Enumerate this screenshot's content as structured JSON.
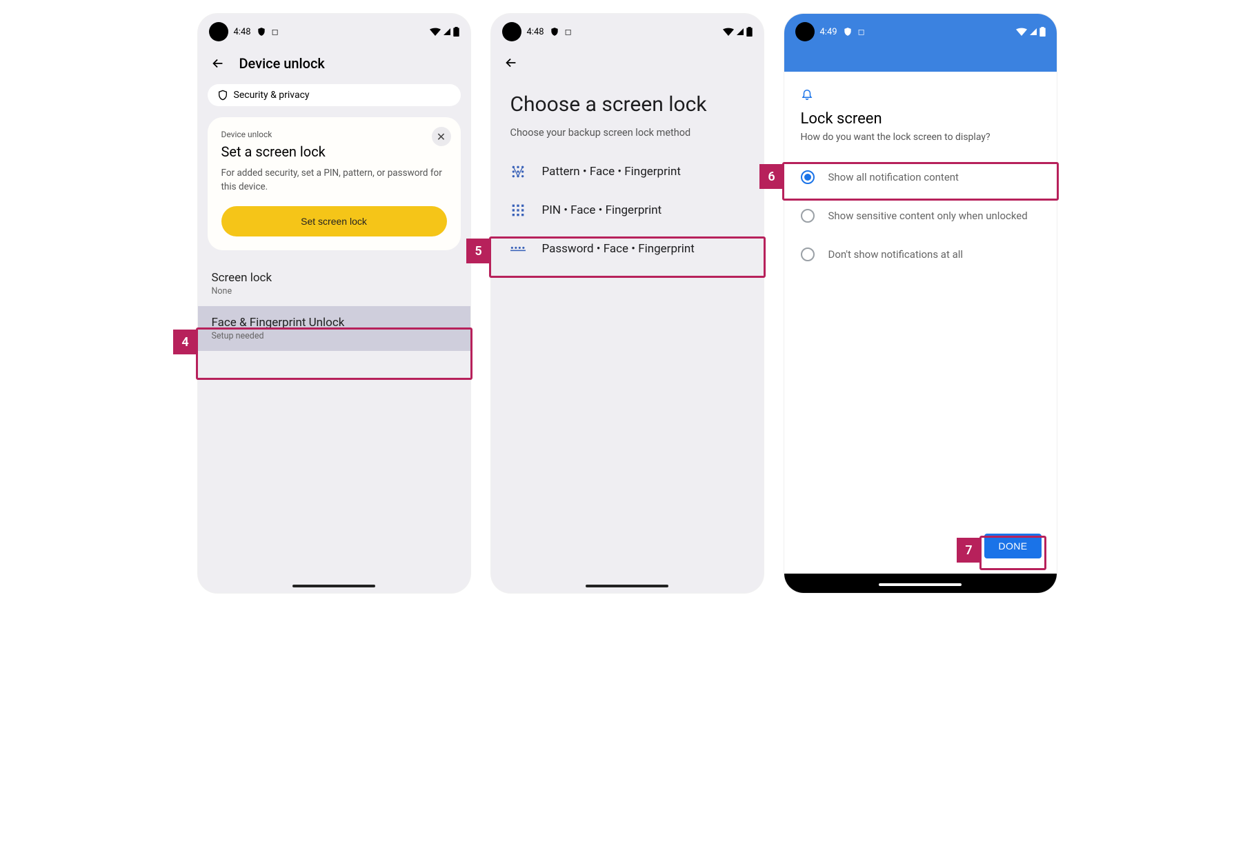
{
  "callouts": {
    "step4": "4",
    "step5": "5",
    "step6": "6",
    "step7": "7"
  },
  "screen1": {
    "status": {
      "time": "4:48"
    },
    "title": "Device unlock",
    "chip_label": "Security & privacy",
    "card": {
      "overline": "Device unlock",
      "title": "Set a screen lock",
      "body": "For added security, set a PIN, pattern, or password for this device.",
      "button": "Set screen lock"
    },
    "screen_lock": {
      "title": "Screen lock",
      "sub": "None"
    },
    "face_fp": {
      "title": "Face & Fingerprint Unlock",
      "sub": "Setup needed"
    }
  },
  "screen2": {
    "status": {
      "time": "4:48"
    },
    "title": "Choose a screen lock",
    "subtitle": "Choose your backup screen lock method",
    "options": {
      "pattern": "Pattern • Face • Fingerprint",
      "pin": "PIN • Face • Fingerprint",
      "password": "Password • Face • Fingerprint"
    }
  },
  "screen3": {
    "status": {
      "time": "4:49"
    },
    "title": "Lock screen",
    "subtitle": "How do you want the lock screen to display?",
    "opts": {
      "a": "Show all notification content",
      "b": "Show sensitive content only when unlocked",
      "c": "Don't show notifications at all"
    },
    "done": "DONE"
  }
}
